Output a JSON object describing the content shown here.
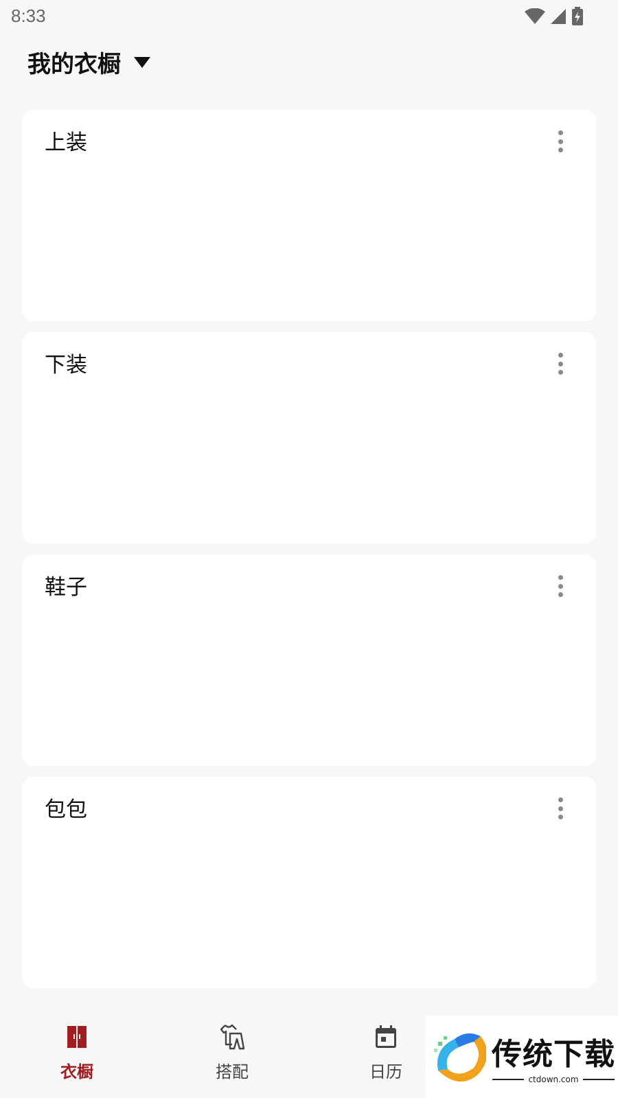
{
  "status": {
    "time": "8:33"
  },
  "header": {
    "title": "我的衣橱"
  },
  "cards": [
    {
      "title": "上装"
    },
    {
      "title": "下装"
    },
    {
      "title": "鞋子"
    },
    {
      "title": "包包"
    }
  ],
  "nav": {
    "items": [
      {
        "label": "衣橱",
        "active": true
      },
      {
        "label": "搭配",
        "active": false
      },
      {
        "label": "日历",
        "active": false
      }
    ]
  },
  "watermark": {
    "main": "传统下载",
    "sub": "ctdown.com"
  },
  "colors": {
    "accent": "#a11d20",
    "background": "#f7f7f7",
    "card": "#ffffff"
  }
}
